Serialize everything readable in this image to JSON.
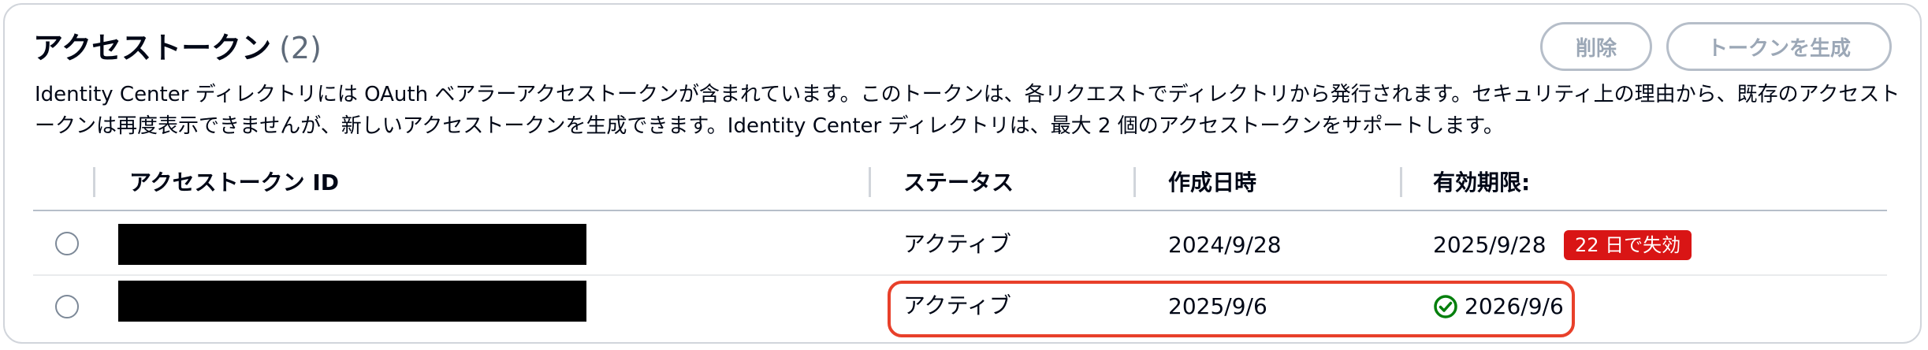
{
  "header": {
    "title": "アクセストークン",
    "count": "(2)"
  },
  "buttons": {
    "delete": "削除",
    "generate": "トークンを生成"
  },
  "description": "Identity Center ディレクトリには OAuth ベアラーアクセストークンが含まれています。このトークンは、各リクエストでディレクトリから発行されます。セキュリティ上の理由から、既存のアクセストークンは再度表示できませんが、新しいアクセストークンを生成できます。Identity Center ディレクトリは、最大 2 個のアクセストークンをサポートします。",
  "table": {
    "columns": [
      "アクセストークン ID",
      "ステータス",
      "作成日時",
      "有効期限:"
    ],
    "rows": [
      {
        "id": "",
        "status": "アクティブ",
        "created": "2024/9/28",
        "expires": "2025/9/28",
        "badge": "22 日で失効"
      },
      {
        "id": "",
        "status": "アクティブ",
        "created": "2025/9/6",
        "expires": "2026/9/6",
        "icon": "check-circle-icon"
      }
    ]
  },
  "colors": {
    "badge_bg": "#d91515",
    "success_green": "#037f0c",
    "highlight_border": "#e8402a"
  }
}
